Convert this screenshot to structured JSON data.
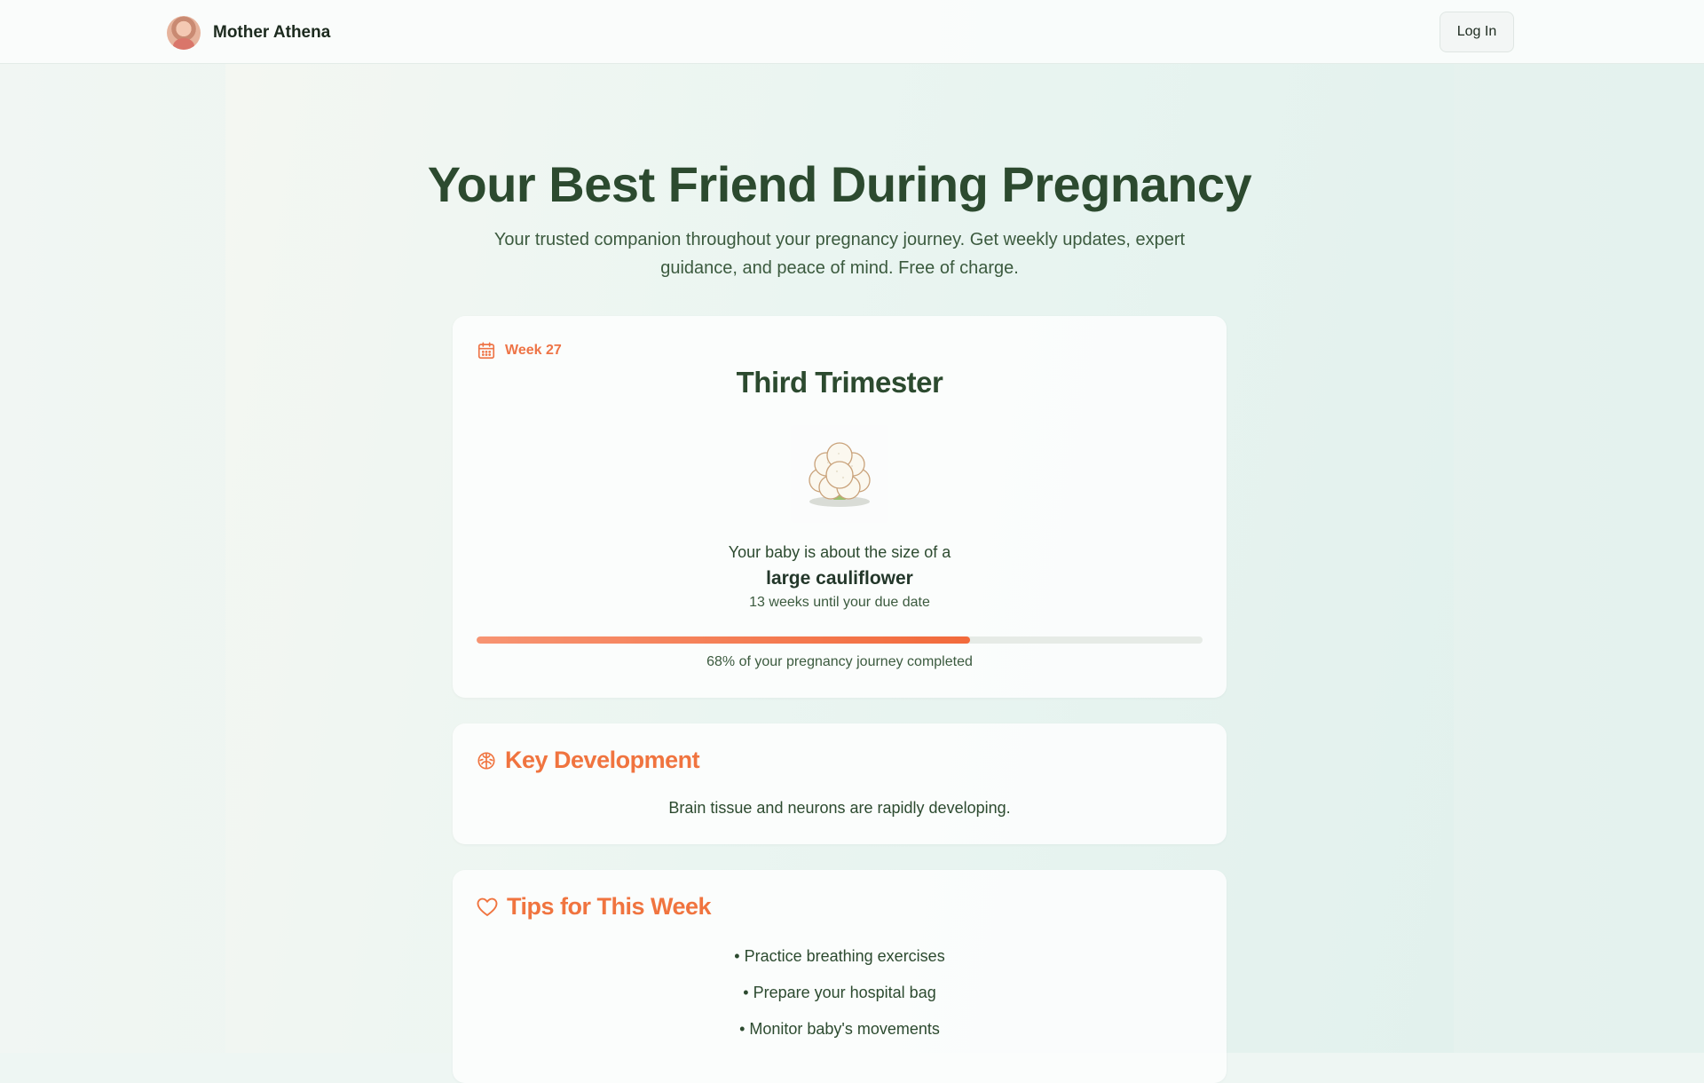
{
  "nav": {
    "brand": "Mother Athena",
    "login_label": "Log In"
  },
  "hero": {
    "title": "Your Best Friend During Pregnancy",
    "subtitle": "Your trusted companion throughout your pregnancy journey. Get weekly updates, expert guidance, and peace of mind. Free of charge."
  },
  "week_card": {
    "week_label": "Week 27",
    "trimester": "Third Trimester",
    "size_intro": "Your baby is about the size of a",
    "size_name": "large cauliflower",
    "due_text": "13 weeks until your due date",
    "progress_fraction": 0.68,
    "progress_label": "68% of your pregnancy journey completed"
  },
  "development": {
    "title": "Key Development",
    "text": "Brain tissue and neurons are rapidly developing."
  },
  "tips": {
    "title": "Tips for This Week",
    "items": [
      "• Practice breathing exercises",
      "• Prepare your hospital bag",
      "• Monitor baby's movements"
    ]
  },
  "colors": {
    "accent": "#f0743f",
    "heading": "#2c4a2f",
    "background": "#e8f4f0"
  },
  "icons": {
    "week": "calendar-icon",
    "development": "brain-icon",
    "tips": "heart-icon",
    "fruit": "cauliflower-illustration"
  }
}
